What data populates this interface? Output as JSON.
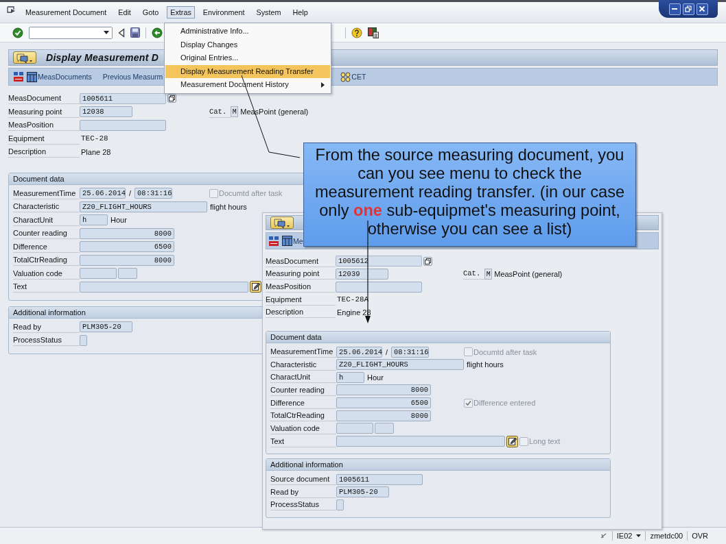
{
  "menu_bar": [
    {
      "label": "Measurement Document",
      "selected": false
    },
    {
      "label": "Edit",
      "selected": false
    },
    {
      "label": "Goto",
      "selected": false
    },
    {
      "label": "Extras",
      "selected": true
    },
    {
      "label": "Environment",
      "selected": false
    },
    {
      "label": "System",
      "selected": false
    },
    {
      "label": "Help",
      "selected": false
    }
  ],
  "extras_menu": [
    {
      "label": "Administrative Info...",
      "selected": false,
      "submenu": false
    },
    {
      "label": "Display Changes",
      "selected": false,
      "submenu": false
    },
    {
      "label": "Original Entries...",
      "selected": false,
      "submenu": false
    },
    {
      "label": "Display Measurement Reading Transfer",
      "selected": true,
      "submenu": false
    },
    {
      "label": "Measurement Document History",
      "selected": false,
      "submenu": true
    }
  ],
  "windows": [
    {
      "title": "Display Measurement D",
      "toolbar": [
        {
          "kind": "overview"
        },
        {
          "kind": "documents",
          "label": "MeasDocuments"
        },
        {
          "kind": "plain",
          "label": "Previous Measurm"
        },
        {
          "kind": "cet",
          "label": "CET"
        }
      ],
      "header": [
        {
          "label": "MeasDocument",
          "kind": "doc",
          "value": "1005611"
        },
        {
          "label": "Measuring point",
          "kind": "input_short",
          "value": "12038",
          "side": {
            "kind": "category",
            "label": "Cat.",
            "code": "M",
            "text": "MeasPoint (general)"
          }
        },
        {
          "label": "MeasPosition",
          "kind": "input_medium"
        },
        {
          "label": "Equipment",
          "kind": "display_code",
          "value": "TEC-28"
        },
        {
          "label": "Description",
          "kind": "display",
          "value": "Plane 28"
        }
      ],
      "sections": [
        {
          "title": "Document data",
          "rows": [
            {
              "label": "MeasurementTime",
              "kind": "datetime",
              "date": "25.06.2014",
              "separator": "/",
              "time": "08:31:16",
              "side": {
                "kind": "checkbox",
                "label": "Documtd after task",
                "checked": false,
                "disabled": true
              }
            },
            {
              "label": "Characteristic",
              "kind": "input_long",
              "value": "Z20_FLIGHT_HOURS",
              "note": "flight hours"
            },
            {
              "label": "CharactUnit",
              "kind": "unit",
              "value": "h",
              "note": "Hour"
            },
            {
              "label": "Counter reading",
              "kind": "number",
              "value": "8000"
            },
            {
              "label": "Difference",
              "kind": "number",
              "value": "6500"
            },
            {
              "label": "TotalCtrReading",
              "kind": "number",
              "value": "8000"
            },
            {
              "label": "Valuation code",
              "kind": "pair"
            },
            {
              "label": "Text",
              "kind": "text"
            }
          ]
        },
        {
          "title": "Additional information",
          "rows": [
            {
              "label": "Read by",
              "kind": "input_short",
              "value": "PLM305-20"
            },
            {
              "label": "ProcessStatus",
              "kind": "status"
            }
          ]
        }
      ]
    },
    {
      "toolbar": [
        {
          "kind": "overview"
        },
        {
          "kind": "documents",
          "label": "Me"
        }
      ],
      "header": [
        {
          "label": "MeasDocument",
          "kind": "doc",
          "value": "1005612"
        },
        {
          "label": "Measuring point",
          "kind": "input_short",
          "value": "12039",
          "side": {
            "kind": "category",
            "label": "Cat.",
            "code": "M",
            "text": "MeasPoint (general)"
          }
        },
        {
          "label": "MeasPosition",
          "kind": "input_medium"
        },
        {
          "label": "Equipment",
          "kind": "display_code",
          "value": "TEC-28A"
        },
        {
          "label": "Description",
          "kind": "display",
          "value": "Engine 28"
        }
      ],
      "sections": [
        {
          "title": "Document data",
          "rows": [
            {
              "label": "MeasurementTime",
              "kind": "datetime",
              "date": "25.06.2014",
              "separator": "/",
              "time": "08:31:16",
              "side": {
                "kind": "checkbox",
                "label": "Documtd after task",
                "checked": false,
                "disabled": true
              }
            },
            {
              "label": "Characteristic",
              "kind": "input_long",
              "value": "Z20_FLIGHT_HOURS",
              "note": "flight hours"
            },
            {
              "label": "CharactUnit",
              "kind": "unit",
              "value": "h",
              "note": "Hour"
            },
            {
              "label": "Counter reading",
              "kind": "number",
              "value": "8000"
            },
            {
              "label": "Difference",
              "kind": "number",
              "value": "6500",
              "side": {
                "kind": "checkbox",
                "label": "Difference entered",
                "checked": true,
                "disabled": true
              }
            },
            {
              "label": "TotalCtrReading",
              "kind": "number",
              "value": "8000"
            },
            {
              "label": "Valuation code",
              "kind": "pair"
            },
            {
              "label": "Text",
              "kind": "text",
              "side": {
                "kind": "checkbox",
                "label": "Long text",
                "checked": false,
                "disabled": true
              }
            }
          ]
        },
        {
          "title": "Additional information",
          "rows": [
            {
              "label": "Source document",
              "kind": "input_medium",
              "value": "1005611"
            },
            {
              "label": "Read by",
              "kind": "input_short",
              "value": "PLM305-20"
            },
            {
              "label": "ProcessStatus",
              "kind": "status"
            }
          ]
        }
      ]
    }
  ],
  "callout": {
    "text": "From the source measuring document, you can you see menu to check the measurement reading transfer. (in our case only **one** sub-equipmet's measuring point, otherwise you can see a list)"
  },
  "status_bar": {
    "transaction": "IE02",
    "server": "zmetdc00",
    "mode": "OVR"
  }
}
